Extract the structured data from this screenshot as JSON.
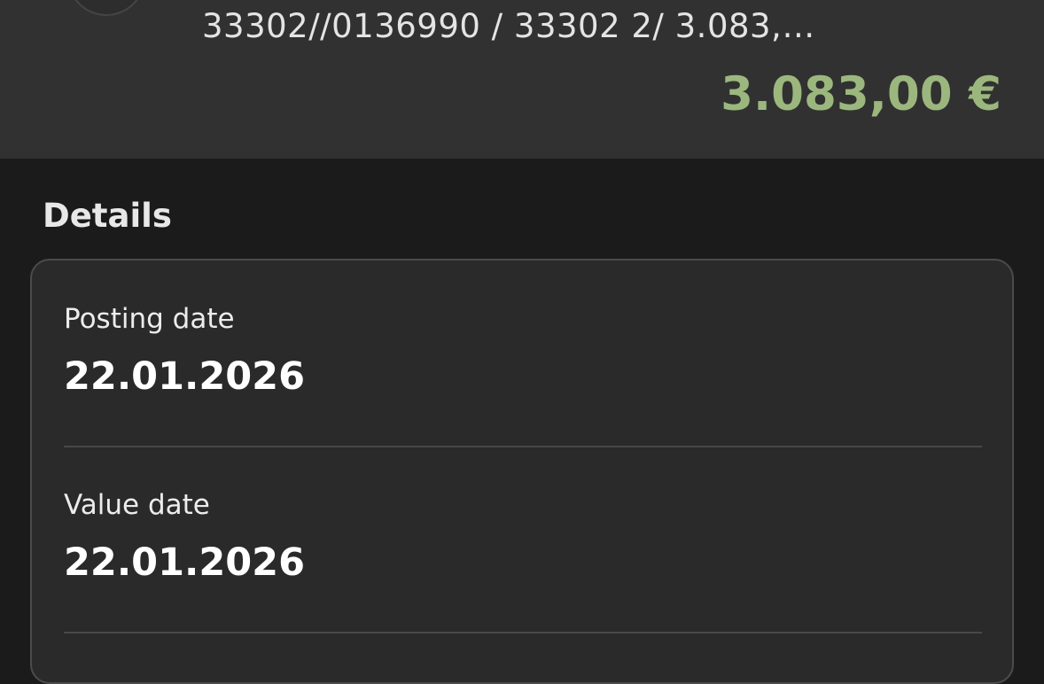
{
  "transaction": {
    "reference": "33302//0136990 / 33302 2/ 3.083,…",
    "amount": "3.083,00 €",
    "amount_color": "#9cb77e"
  },
  "details": {
    "title": "Details",
    "fields": [
      {
        "label": "Posting date",
        "value": "22.01.2026"
      },
      {
        "label": "Value date",
        "value": "22.01.2026"
      }
    ]
  }
}
